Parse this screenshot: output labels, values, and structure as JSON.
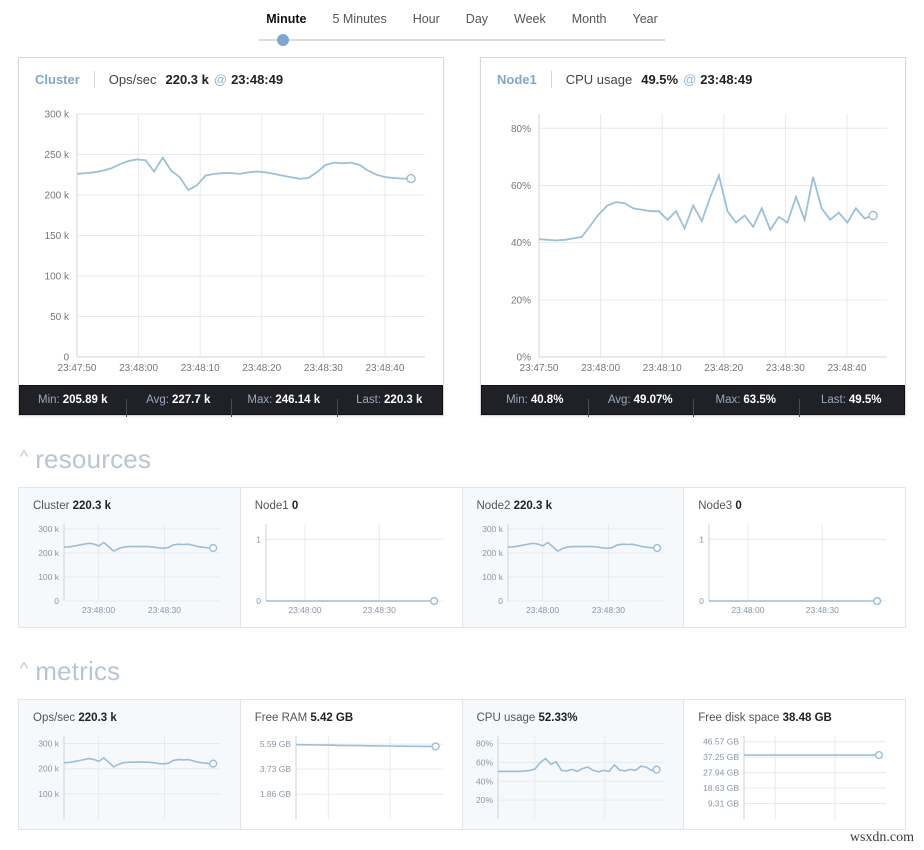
{
  "timerange": {
    "options": [
      "Minute",
      "5 Minutes",
      "Hour",
      "Day",
      "Week",
      "Month",
      "Year"
    ],
    "selected": "Minute"
  },
  "big_charts": [
    {
      "node": "Cluster",
      "metric": "Ops/sec",
      "value": "220.3 k",
      "at_symbol": "@",
      "time": "23:48:49",
      "stats": [
        {
          "label": "Min:",
          "value": "205.89 k"
        },
        {
          "label": "Avg:",
          "value": "227.7 k"
        },
        {
          "label": "Max:",
          "value": "246.14 k"
        },
        {
          "label": "Last:",
          "value": "220.3 k"
        }
      ],
      "chart_data": {
        "type": "line",
        "title": "Cluster Ops/sec",
        "ylabel": "",
        "xlabel": "",
        "ylim": [
          0,
          300000
        ],
        "yticks": [
          0,
          50000,
          100000,
          150000,
          200000,
          250000,
          300000
        ],
        "ytick_labels": [
          "0",
          "50 k",
          "100 k",
          "150 k",
          "200 k",
          "250 k",
          "300 k"
        ],
        "xtick_labels": [
          "23:47:50",
          "23:48:00",
          "23:48:10",
          "23:48:20",
          "23:48:30",
          "23:48:40"
        ],
        "grid": true,
        "values": [
          226000,
          227000,
          228000,
          230000,
          233000,
          238000,
          242000,
          244000,
          243000,
          229000,
          246140,
          230000,
          222000,
          205890,
          212000,
          224000,
          226000,
          227000,
          227000,
          226000,
          228000,
          229000,
          228000,
          226000,
          224000,
          222000,
          220000,
          221000,
          228000,
          237000,
          240000,
          239000,
          240000,
          237000,
          230000,
          225000,
          222000,
          221000,
          220300,
          220300
        ]
      }
    },
    {
      "node": "Node1",
      "metric": "CPU usage",
      "value": "49.5%",
      "at_symbol": "@",
      "time": "23:48:49",
      "stats": [
        {
          "label": "Min:",
          "value": "40.8%"
        },
        {
          "label": "Avg:",
          "value": "49.07%"
        },
        {
          "label": "Max:",
          "value": "63.5%"
        },
        {
          "label": "Last:",
          "value": "49.5%"
        }
      ],
      "chart_data": {
        "type": "line",
        "title": "Node1 CPU usage",
        "ylabel": "",
        "xlabel": "",
        "ylim": [
          0,
          85
        ],
        "yticks": [
          0,
          20,
          40,
          60,
          80
        ],
        "ytick_labels": [
          "0%",
          "20%",
          "40%",
          "60%",
          "80%"
        ],
        "xtick_labels": [
          "23:47:50",
          "23:48:00",
          "23:48:10",
          "23:48:20",
          "23:48:30",
          "23:48:40"
        ],
        "grid": true,
        "values": [
          41.2,
          41.0,
          40.8,
          41.0,
          41.5,
          42.0,
          46.0,
          50.0,
          53.0,
          54.2,
          53.8,
          52.0,
          51.5,
          51.0,
          51.0,
          48.0,
          51.0,
          45.0,
          53.0,
          47.5,
          56.0,
          63.5,
          51.0,
          47.0,
          49.5,
          45.5,
          52.0,
          44.5,
          49.0,
          47.0,
          56.0,
          48.0,
          63.0,
          52.0,
          48.0,
          50.5,
          47.0,
          52.0,
          48.5,
          49.5
        ]
      }
    }
  ],
  "sections": [
    {
      "id": "resources",
      "caret": "^",
      "title": "resources",
      "cards": [
        {
          "label": "Cluster",
          "value": "220.3 k",
          "shaded": true,
          "chart_data": {
            "type": "line",
            "ylim": [
              0,
              320000
            ],
            "yticks": [
              0,
              100000,
              200000,
              300000
            ],
            "ytick_labels": [
              "0",
              "100 k",
              "200 k",
              "300 k"
            ],
            "xtick_labels": [
              "23:48:00",
              "23:48:30"
            ],
            "grid": true,
            "values": [
              224000,
              225000,
              228000,
              232000,
              236000,
              240000,
              237000,
              229000,
              243000,
              226000,
              207000,
              218000,
              224000,
              226000,
              226000,
              227000,
              226000,
              226000,
              224000,
              221000,
              219000,
              222000,
              233000,
              236000,
              235000,
              236000,
              231000,
              226000,
              223000,
              221000,
              220300
            ]
          }
        },
        {
          "label": "Node1",
          "value": "0",
          "shaded": false,
          "chart_data": {
            "type": "line",
            "ylim": [
              0,
              1.25
            ],
            "yticks": [
              0,
              1
            ],
            "ytick_labels": [
              "0",
              "1"
            ],
            "xtick_labels": [
              "23:48:00",
              "23:48:30"
            ],
            "grid": true,
            "values": [
              0,
              0,
              0,
              0,
              0,
              0,
              0,
              0,
              0,
              0,
              0,
              0,
              0,
              0,
              0,
              0,
              0,
              0,
              0,
              0,
              0,
              0,
              0,
              0,
              0,
              0,
              0,
              0,
              0,
              0,
              0
            ]
          }
        },
        {
          "label": "Node2",
          "value": "220.3 k",
          "shaded": true,
          "chart_data": {
            "type": "line",
            "ylim": [
              0,
              320000
            ],
            "yticks": [
              0,
              100000,
              200000,
              300000
            ],
            "ytick_labels": [
              "0",
              "100 k",
              "200 k",
              "300 k"
            ],
            "xtick_labels": [
              "23:48:00",
              "23:48:30"
            ],
            "grid": true,
            "values": [
              224000,
              225000,
              228000,
              232000,
              236000,
              240000,
              237000,
              229000,
              243000,
              226000,
              207000,
              218000,
              224000,
              226000,
              226000,
              227000,
              226000,
              226000,
              224000,
              221000,
              219000,
              222000,
              233000,
              236000,
              235000,
              236000,
              231000,
              226000,
              223000,
              221000,
              220300
            ]
          }
        },
        {
          "label": "Node3",
          "value": "0",
          "shaded": false,
          "chart_data": {
            "type": "line",
            "ylim": [
              0,
              1.25
            ],
            "yticks": [
              0,
              1
            ],
            "ytick_labels": [
              "0",
              "1"
            ],
            "xtick_labels": [
              "23:48:00",
              "23:48:30"
            ],
            "grid": true,
            "values": [
              0,
              0,
              0,
              0,
              0,
              0,
              0,
              0,
              0,
              0,
              0,
              0,
              0,
              0,
              0,
              0,
              0,
              0,
              0,
              0,
              0,
              0,
              0,
              0,
              0,
              0,
              0,
              0,
              0,
              0,
              0
            ]
          }
        }
      ]
    },
    {
      "id": "metrics",
      "caret": "^",
      "title": "metrics",
      "cards": [
        {
          "label": "Ops/sec",
          "value": "220.3 k",
          "shaded": true,
          "chart_data": {
            "type": "line",
            "ylim": [
              0,
              330000
            ],
            "yticks": [
              100000,
              200000,
              300000
            ],
            "ytick_labels": [
              "100 k",
              "200 k",
              "300 k"
            ],
            "xtick_labels": [],
            "grid": true,
            "values": [
              224000,
              225000,
              228000,
              232000,
              236000,
              240000,
              237000,
              229000,
              243000,
              226000,
              207000,
              218000,
              224000,
              226000,
              226000,
              227000,
              226000,
              226000,
              224000,
              221000,
              219000,
              222000,
              233000,
              236000,
              235000,
              236000,
              231000,
              226000,
              223000,
              221000,
              220300
            ]
          }
        },
        {
          "label": "Free RAM",
          "value": "5.42 GB",
          "shaded": false,
          "chart_data": {
            "type": "line",
            "ylim": [
              0,
              6.2
            ],
            "yticks": [
              1.86,
              3.73,
              5.59
            ],
            "ytick_labels": [
              "1.86 GB",
              "3.73 GB",
              "5.59 GB"
            ],
            "xtick_labels": [],
            "grid": true,
            "values": [
              5.55,
              5.55,
              5.54,
              5.54,
              5.53,
              5.53,
              5.52,
              5.52,
              5.51,
              5.5,
              5.5,
              5.49,
              5.49,
              5.48,
              5.48,
              5.47,
              5.47,
              5.46,
              5.46,
              5.45,
              5.45,
              5.45,
              5.44,
              5.44,
              5.43,
              5.43,
              5.43,
              5.42,
              5.42,
              5.42,
              5.42
            ]
          }
        },
        {
          "label": "CPU usage",
          "value": "52.33%",
          "shaded": true,
          "chart_data": {
            "type": "line",
            "ylim": [
              0,
              88
            ],
            "yticks": [
              20,
              40,
              60,
              80
            ],
            "ytick_labels": [
              "20%",
              "40%",
              "60%",
              "80%"
            ],
            "xtick_labels": [],
            "grid": true,
            "values": [
              50.5,
              50.5,
              50.5,
              50.5,
              50.5,
              51.0,
              51.5,
              53.0,
              60.0,
              64.0,
              58.0,
              60.5,
              51.5,
              51.0,
              52.5,
              50.5,
              53.5,
              55.0,
              51.5,
              50.0,
              51.5,
              50.5,
              57.5,
              52.0,
              51.0,
              52.5,
              51.5,
              56.0,
              55.0,
              51.5,
              52.33
            ]
          }
        },
        {
          "label": "Free disk space",
          "value": "38.48 GB",
          "shaded": false,
          "chart_data": {
            "type": "line",
            "ylim": [
              0,
              50
            ],
            "yticks": [
              9.31,
              18.63,
              27.94,
              37.25,
              46.57
            ],
            "ytick_labels": [
              "9.31 GB",
              "18.63 GB",
              "27.94 GB",
              "37.25 GB",
              "46.57 GB"
            ],
            "xtick_labels": [],
            "grid": true,
            "values": [
              38.48,
              38.48,
              38.48,
              38.48,
              38.48,
              38.48,
              38.48,
              38.48,
              38.48,
              38.48,
              38.48,
              38.48,
              38.48,
              38.48,
              38.48,
              38.48,
              38.48,
              38.48,
              38.48,
              38.48,
              38.48,
              38.48,
              38.48,
              38.48,
              38.48,
              38.48,
              38.48,
              38.48,
              38.48,
              38.48,
              38.48
            ]
          }
        }
      ]
    }
  ],
  "watermark": "wsxdn.com"
}
